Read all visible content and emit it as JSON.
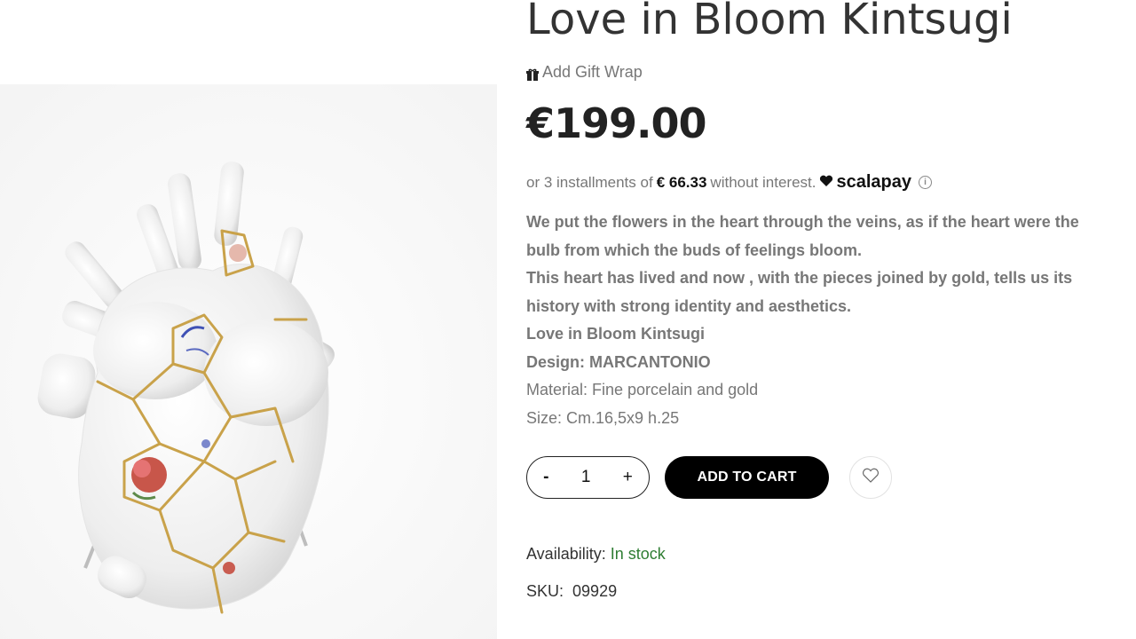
{
  "product": {
    "title": "Love in Bloom Kintsugi",
    "gift_wrap_label": "Add Gift Wrap",
    "price": "€199.00",
    "installments": {
      "prefix": "or 3 installments of",
      "amount": "€ 66.33",
      "suffix": "without interest.",
      "provider": "scalapay",
      "info_icon": "info-icon"
    },
    "description": [
      {
        "text": "We put the flowers in the heart through the veins, as if the heart were the",
        "bold": true
      },
      {
        "text": "bulb from which the buds of feelings bloom.",
        "bold": true
      },
      {
        "text": "This heart has lived and now , with the pieces joined by gold, tells us its",
        "bold": true
      },
      {
        "text": "history with strong identity and aesthetics.",
        "bold": true
      },
      {
        "text": "Love in Bloom Kintsugi",
        "bold": true
      },
      {
        "text": "Design: MARCANTONIO",
        "bold": true
      },
      {
        "text": "Material: Fine porcelain and gold",
        "bold": false
      },
      {
        "text": "Size: Cm.16,5x9 h.25",
        "bold": false
      }
    ],
    "quantity": {
      "minus": "-",
      "value": "1",
      "plus": "+"
    },
    "add_to_cart": "ADD TO CART",
    "wishlist_icon": "heart-outline-icon",
    "availability_label": "Availability:",
    "availability_value": "In stock",
    "sku_label": "SKU:",
    "sku_value": "09929"
  },
  "colors": {
    "accent_black": "#000000",
    "stock_green": "#2e7d32",
    "muted_text": "#777777",
    "gold": "#c9a24a"
  }
}
